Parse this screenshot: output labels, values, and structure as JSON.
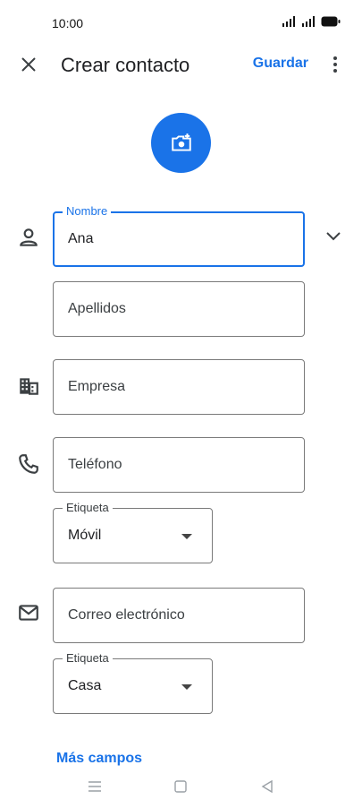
{
  "status_bar": {
    "time": "10:00"
  },
  "app_bar": {
    "title": "Crear contacto",
    "save_label": "Guardar"
  },
  "form": {
    "first_name": {
      "label": "Nombre",
      "value": "Ana"
    },
    "last_name": {
      "placeholder": "Apellidos"
    },
    "company": {
      "placeholder": "Empresa"
    },
    "phone": {
      "placeholder": "Teléfono"
    },
    "phone_label": {
      "label": "Etiqueta",
      "value": "Móvil"
    },
    "email": {
      "placeholder": "Correo electrónico"
    },
    "email_label": {
      "label": "Etiqueta",
      "value": "Casa"
    }
  },
  "more_fields_label": "Más campos",
  "colors": {
    "accent": "#1a73e8",
    "text": "#202124",
    "border": "#7a7a7a"
  }
}
